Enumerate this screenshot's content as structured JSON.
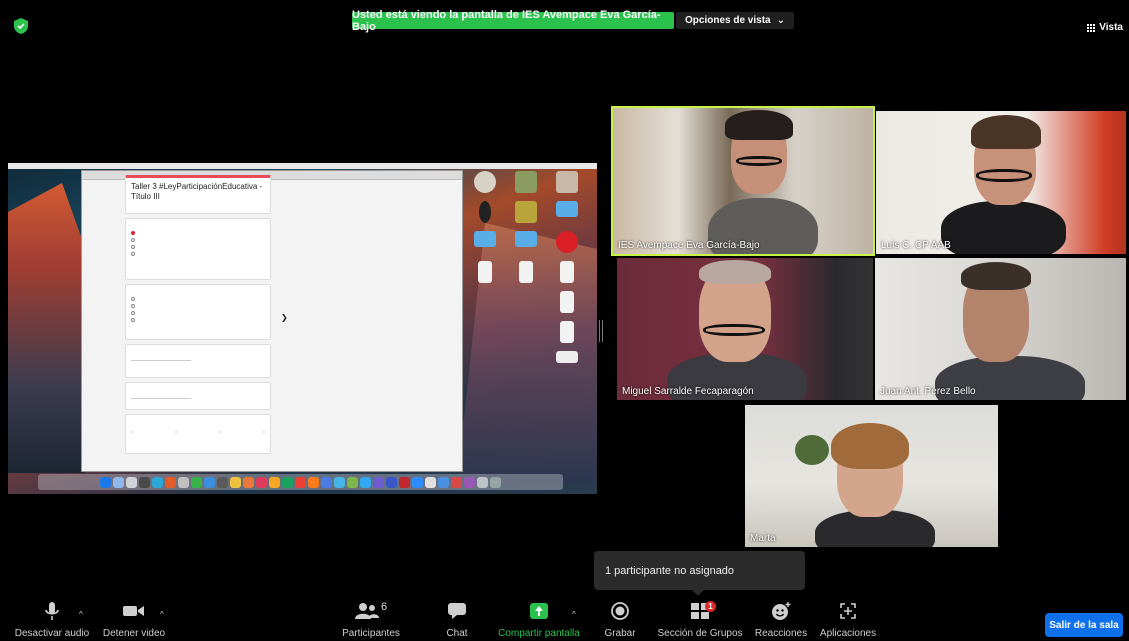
{
  "top": {
    "share_banner": "Usted está viendo la pantalla de IES Avempace Eva García-Bajo",
    "view_options": "Opciones de vista",
    "view_button": "Vista"
  },
  "shared_screen": {
    "form_title": "Taller 3 #LeyParticipaciónEducativa - Título III"
  },
  "participants": [
    {
      "name": "IES Avempace Eva García-Bajo"
    },
    {
      "name": "Luis C. CP AAB"
    },
    {
      "name": "Miguel Sarralde Fecaparagón"
    },
    {
      "name": "Juan Ant. Pérez Bello"
    },
    {
      "name": "Marta"
    }
  ],
  "notification": "1 participante no asignado",
  "toolbar": {
    "mute": "Desactivar audio",
    "stop_video": "Detener video",
    "participants": "Participantes",
    "participants_count": "6",
    "chat": "Chat",
    "share": "Compartir pantalla",
    "record": "Grabar",
    "breakout": "Sección de Grupos",
    "breakout_badge": "1",
    "reactions": "Reacciones",
    "apps": "Aplicaciones",
    "leave": "Salir de la sala"
  },
  "colors": {
    "share_green": "#2ac24d",
    "active_speaker": "#c6f24a",
    "leave_blue": "#0e71eb",
    "badge_red": "#e02828"
  }
}
